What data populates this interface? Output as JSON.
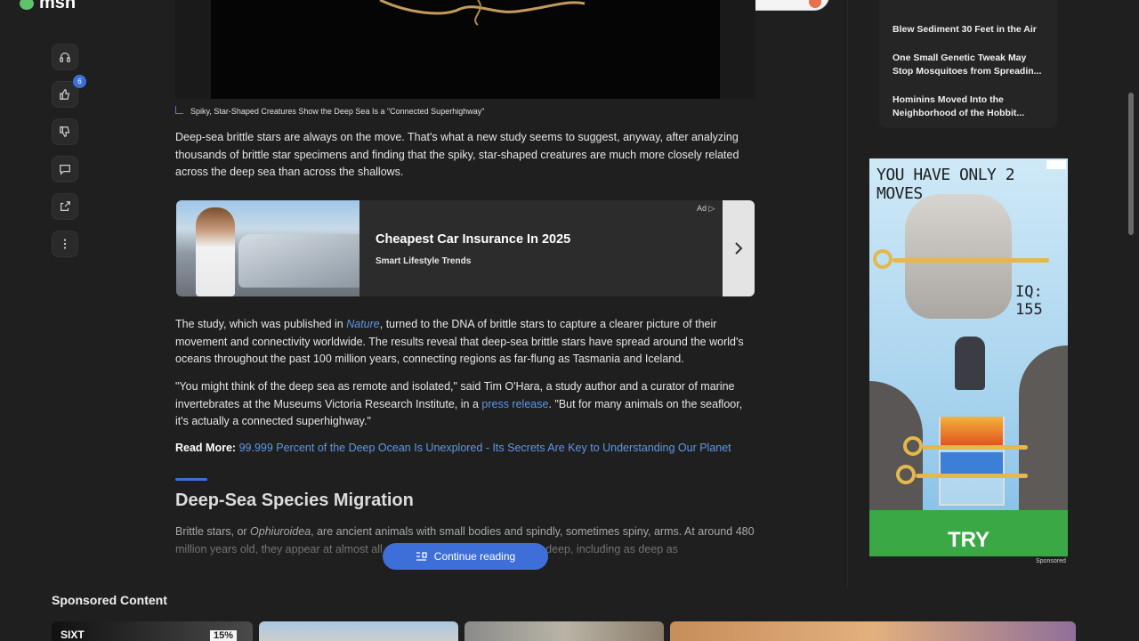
{
  "header": {
    "logo_text": "msn"
  },
  "rail": {
    "like_count": "6"
  },
  "article": {
    "caption": "Spiky, Star-Shaped Creatures Show the Deep Sea Is a \"Connected Superhighway\"",
    "p1": "Deep-sea brittle stars are always on the move. That's what a new study seems to suggest, anyway, after analyzing thousands of brittle star specimens and finding that the spiky, star-shaped creatures are much more closely related across the deep sea than across the shallows.",
    "p2_before": "The study, which was published in ",
    "p2_link": "Nature",
    "p2_after": ", turned to the DNA of brittle stars to capture a clearer picture of their movement and connectivity worldwide. The results reveal that deep-sea brittle stars have spread around the world's oceans throughout the past 100 million years, connecting regions as far-flung as Tasmania and Iceland.",
    "p3_before": "\"You might think of the deep sea as remote and isolated,\" said Tim O'Hara, a study author and a curator of marine invertebrates at the Museums Victoria Research Institute, in a ",
    "p3_link": "press release",
    "p3_after": ". \"But for many animals on the seafloor, it's actually a connected superhighway.\"",
    "read_more_label": "Read More:",
    "read_more_link": "99.999 Percent of the Deep Ocean Is Unexplored - Its Secrets Are Key to Understanding Our Planet",
    "section_heading": "Deep-Sea Species Migration",
    "p4_before": "Brittle stars, or ",
    "p4_em": "Ophiuroidea",
    "p4_after": ", are ancient animals with small bodies and spindly, sometimes spiny, arms. At around 480 million years old, they appear at almost all depths, from the shallows to the deep, including as deep as",
    "continue_label": "Continue reading"
  },
  "ad": {
    "title": "Cheapest Car Insurance In 2025",
    "source": "Smart Lifestyle Trends",
    "tag": "Ad"
  },
  "sidebar": {
    "news": [
      "Blew Sediment 30 Feet in the Air",
      "One Small Genetic Tweak May Stop Mosquitoes from Spreadin...",
      "Hominins Moved Into the Neighborhood of the Hobbit..."
    ],
    "game_ad": {
      "headline": "YOU HAVE ONLY 2 MOVES",
      "iq": "IQ: 155",
      "cta": "TRY",
      "sponsored": "Sponsored"
    }
  },
  "sponsored_content": {
    "title": "Sponsored Content",
    "thumb1_logo": "SIXT",
    "thumb1_percent": "15%"
  },
  "colors": {
    "accent": "#3e6fd8",
    "link": "#5f97e8",
    "background": "#1f1f1f"
  }
}
